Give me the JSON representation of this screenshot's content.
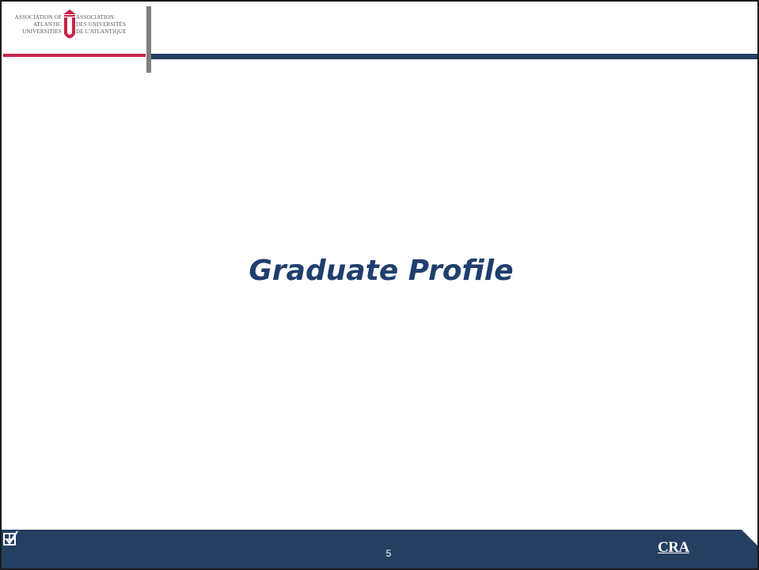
{
  "header": {
    "logo_left_text": "ASSOCIATION OF\nATLANTIC\nUNIVERSITIES",
    "logo_right_text": "ASSOCIATION\nDES UNIVERSITÉS\nDE L'ATLANTIQUE"
  },
  "slide": {
    "title": "Graduate Profile"
  },
  "footer": {
    "page_number": "5",
    "brand": "CRA"
  },
  "colors": {
    "navy": "#243f60",
    "title_blue": "#1f3f6e",
    "accent_red": "#c8234a",
    "grey_bar": "#7f7f7f"
  }
}
